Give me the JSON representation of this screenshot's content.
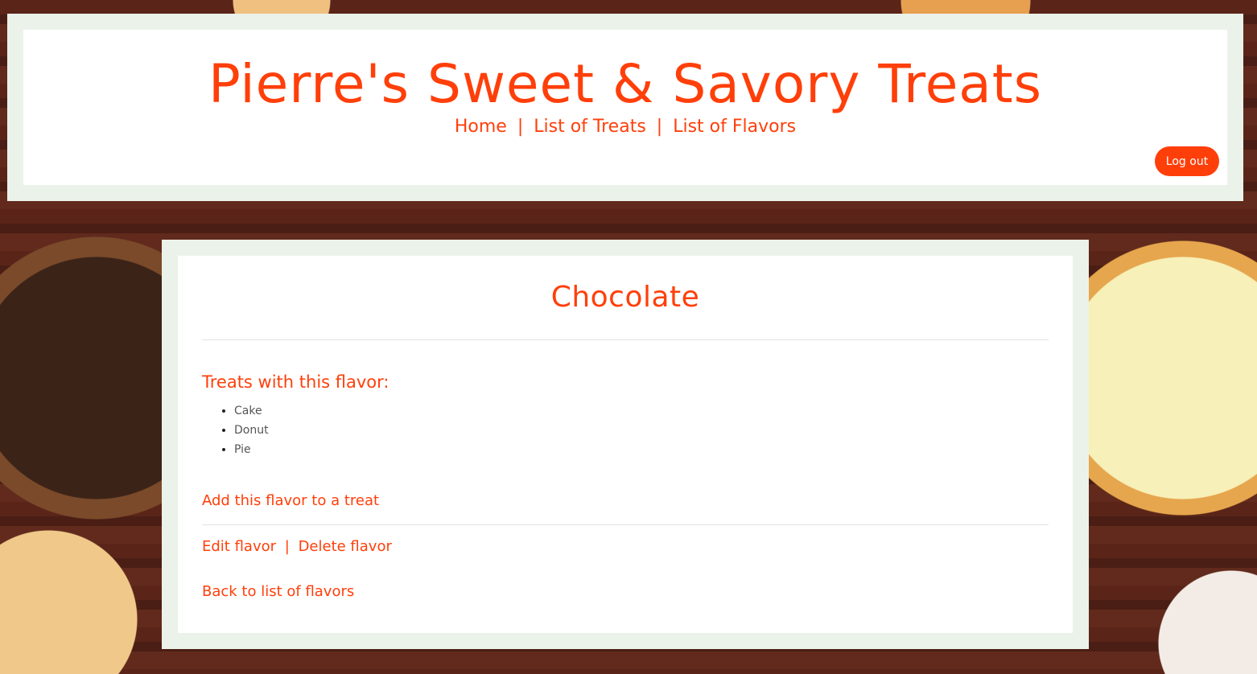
{
  "header": {
    "site_title": "Pierre's Sweet & Savory Treats",
    "nav": {
      "home": "Home",
      "treats": "List of Treats",
      "flavors": "List of Flavors",
      "separator": "|"
    },
    "logout_label": "Log out"
  },
  "flavor": {
    "name": "Chocolate",
    "treats_heading": "Treats with this flavor:",
    "treats": [
      "Cake",
      "Donut",
      "Pie"
    ]
  },
  "actions": {
    "add_to_treat": "Add this flavor to a treat",
    "edit": "Edit flavor",
    "separator": "|",
    "delete": "Delete flavor",
    "back": "Back to list of flavors"
  },
  "colors": {
    "accent": "#ff3f0a",
    "frame": "#ebf2ea",
    "panel": "#ffffff",
    "list_text": "#555555"
  }
}
